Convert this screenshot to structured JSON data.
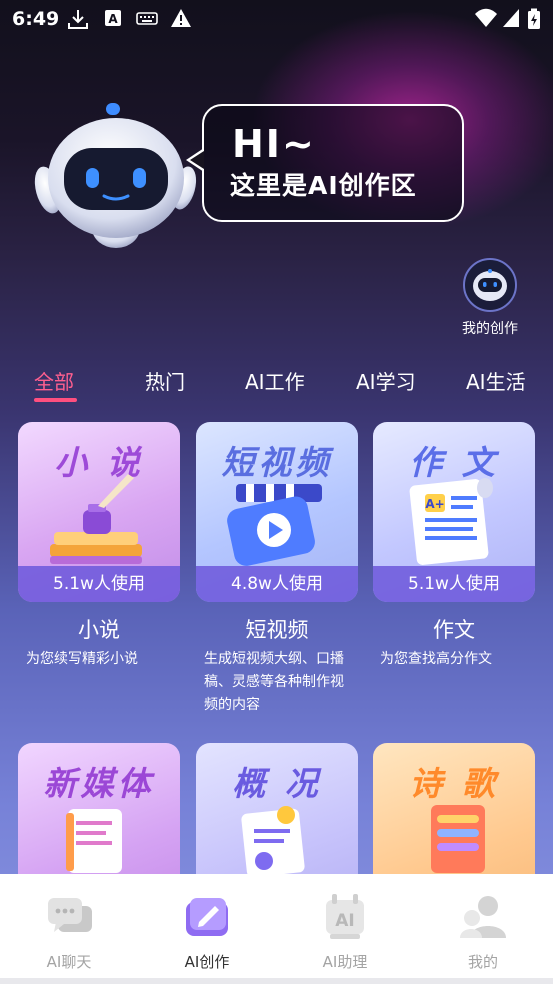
{
  "status": {
    "time": "6:49",
    "icons": [
      "download-icon",
      "app-a-icon",
      "keyboard-icon",
      "warning-icon",
      "wifi-icon",
      "signal-icon",
      "battery-charging-icon"
    ]
  },
  "hero": {
    "greeting": "HI~",
    "intro": "这里是AI创作区",
    "my_creation_label": "我的创作"
  },
  "tabs": [
    {
      "label": "全部",
      "active": true
    },
    {
      "label": "热门",
      "active": false
    },
    {
      "label": "AI工作",
      "active": false
    },
    {
      "label": "AI学习",
      "active": false
    },
    {
      "label": "AI生活",
      "active": false
    }
  ],
  "cards": [
    {
      "art_title": "小 说",
      "usage": "5.1w人使用",
      "name": "小说",
      "desc": "为您续写精彩小说"
    },
    {
      "art_title": "短视频",
      "usage": "4.8w人使用",
      "name": "短视频",
      "desc": "生成短视频大纲、口播稿、灵感等各种制作视频的内容"
    },
    {
      "art_title": "作 文",
      "usage": "5.1w人使用",
      "name": "作文",
      "desc": "为您查找高分作文"
    },
    {
      "art_title": "新媒体"
    },
    {
      "art_title": "概 况"
    },
    {
      "art_title": "诗 歌"
    }
  ],
  "nav": [
    {
      "label": "AI聊天",
      "icon": "chat-icon",
      "active": false
    },
    {
      "label": "AI创作",
      "icon": "create-icon",
      "active": true
    },
    {
      "label": "AI助理",
      "icon": "assistant-icon",
      "active": false
    },
    {
      "label": "我的",
      "icon": "profile-icon",
      "active": false
    }
  ],
  "colors": {
    "accent": "#ff4f7f",
    "usage_bar": "#6e5adc"
  }
}
